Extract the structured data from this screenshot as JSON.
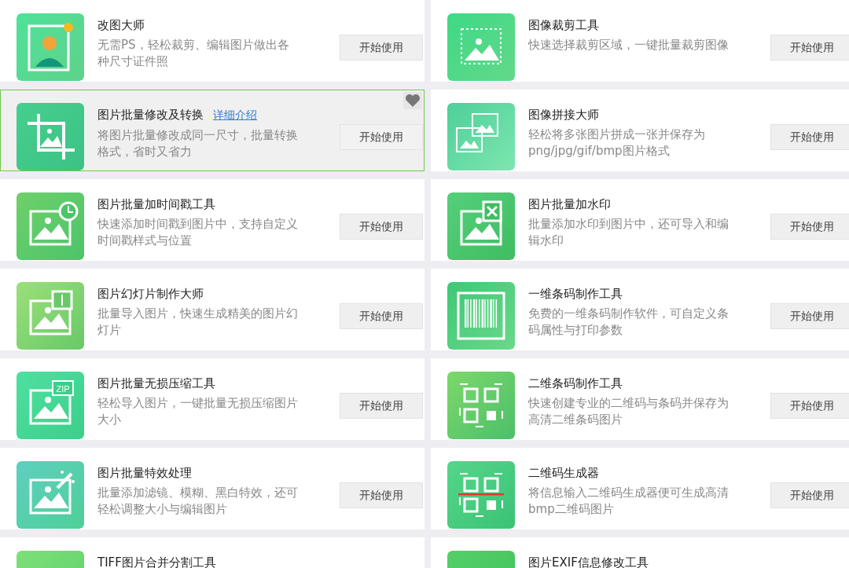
{
  "cards": [
    {
      "title": "改图大师",
      "description": "无需PS，轻松裁剪、编辑图片做出各种尺寸证件照",
      "button": "开始使用",
      "selected": false
    },
    {
      "title": "图像裁剪工具",
      "description": "快速选择裁剪区域，一键批量裁剪图像",
      "button": "开始使用",
      "selected": false
    },
    {
      "title": "图片批量修改及转换",
      "link": "详细介绍",
      "description": "将图片批量修改成同一尺寸，批量转换格式，省时又省力",
      "button": "开始使用",
      "selected": true
    },
    {
      "title": "图像拼接大师",
      "description": "轻松将多张图片拼成一张并保存为png/jpg/gif/bmp图片格式",
      "button": "开始使用",
      "selected": false
    },
    {
      "title": "图片批量加时间戳工具",
      "description": "快速添加时间戳到图片中，支持自定义时间戳样式与位置",
      "button": "开始使用",
      "selected": false
    },
    {
      "title": "图片批量加水印",
      "description": "批量添加水印到图片中，还可导入和编辑水印",
      "button": "开始使用",
      "selected": false
    },
    {
      "title": "图片幻灯片制作大师",
      "description": "批量导入图片，快速生成精美的图片幻灯片",
      "button": "开始使用",
      "selected": false
    },
    {
      "title": "一维条码制作工具",
      "description": "免费的一维条码制作软件，可自定义条码属性与打印参数",
      "button": "开始使用",
      "selected": false
    },
    {
      "title": "图片批量无损压缩工具",
      "icon_label": "ZIP",
      "description": "轻松导入图片，一键批量无损压缩图片大小",
      "button": "开始使用",
      "selected": false
    },
    {
      "title": "二维条码制作工具",
      "description": "快速创建专业的二维码与条码并保存为高清二维条码图片",
      "button": "开始使用",
      "selected": false
    },
    {
      "title": "图片批量特效处理",
      "description": "批量添加滤镜、模糊、黑白特效，还可轻松调整大小与编辑图片",
      "button": "开始使用",
      "selected": false
    },
    {
      "title": "二维码生成器",
      "description": "将信息输入二维码生成器便可生成高清bmp二维码图片",
      "button": "开始使用",
      "selected": false
    },
    {
      "title": "TIFF图片合并分割工具",
      "selected": false
    },
    {
      "title": "图片EXIF信息修改工具",
      "selected": false
    }
  ]
}
